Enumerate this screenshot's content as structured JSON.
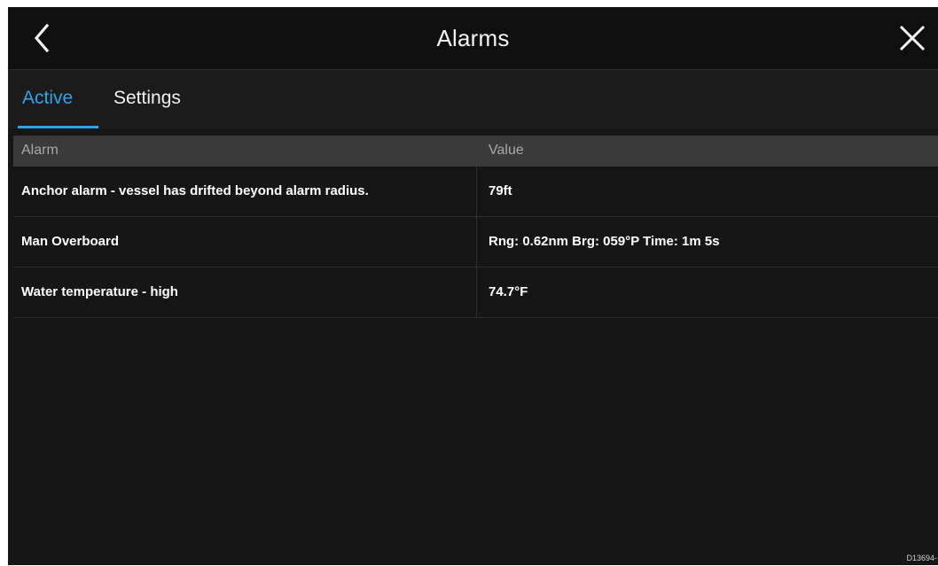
{
  "header": {
    "title": "Alarms",
    "back_icon": "chevron-left-icon",
    "close_icon": "close-icon"
  },
  "tabs": [
    {
      "label": "Active",
      "selected": true
    },
    {
      "label": "Settings",
      "selected": false
    }
  ],
  "table": {
    "columns": [
      "Alarm",
      "Value"
    ],
    "rows": [
      {
        "alarm": "Anchor alarm - vessel has drifted beyond alarm radius.",
        "value": "79ft"
      },
      {
        "alarm": "Man Overboard",
        "value": "Rng: 0.62nm Brg: 059°P Time:  1m  5s"
      },
      {
        "alarm": "Water temperature - high",
        "value": "74.7°F"
      }
    ]
  },
  "ref_code": "D13694-",
  "colors": {
    "accent": "#2ea3e6",
    "background": "#161616",
    "header_row": "#3a3a3a"
  }
}
